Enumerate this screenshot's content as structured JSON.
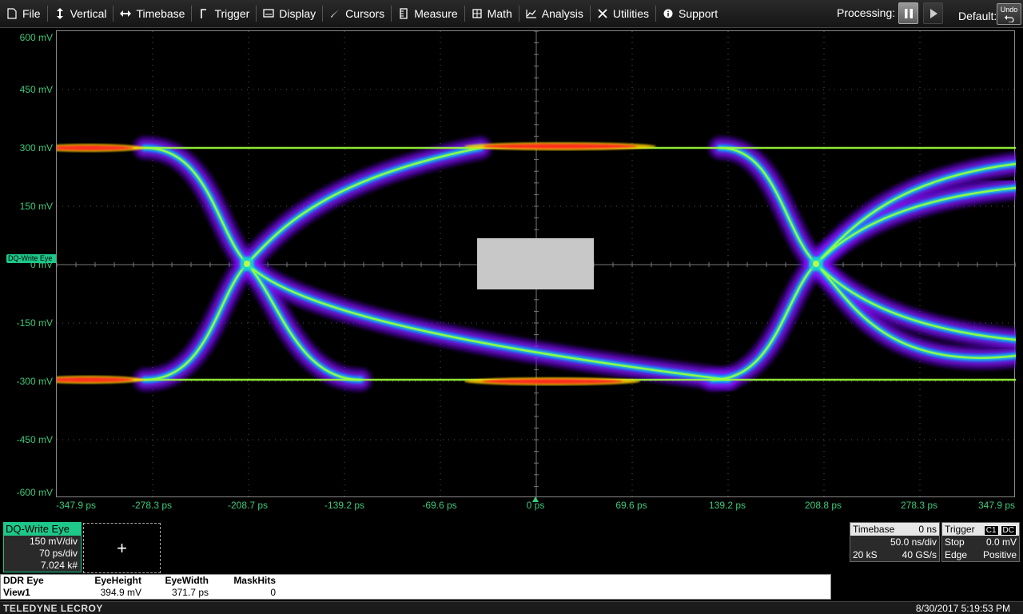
{
  "menu": {
    "items": [
      {
        "key": "file",
        "label": "File",
        "icon": "file-icon"
      },
      {
        "key": "vertical",
        "label": "Vertical",
        "icon": "vertical-arrows-icon"
      },
      {
        "key": "timebase",
        "label": "Timebase",
        "icon": "horizontal-arrows-icon"
      },
      {
        "key": "trigger",
        "label": "Trigger",
        "icon": "trigger-icon"
      },
      {
        "key": "display",
        "label": "Display",
        "icon": "display-icon"
      },
      {
        "key": "cursors",
        "label": "Cursors",
        "icon": "cursor-icon"
      },
      {
        "key": "measure",
        "label": "Measure",
        "icon": "measure-icon"
      },
      {
        "key": "math",
        "label": "Math",
        "icon": "calculator-icon"
      },
      {
        "key": "analysis",
        "label": "Analysis",
        "icon": "analysis-icon"
      },
      {
        "key": "utilities",
        "label": "Utilities",
        "icon": "tools-icon"
      },
      {
        "key": "support",
        "label": "Support",
        "icon": "info-icon"
      }
    ],
    "processing_label": "Processing:",
    "default_label": "Default:",
    "undo_label": "Undo"
  },
  "grid": {
    "y_labels": [
      "600 mV",
      "450 mV",
      "300 mV",
      "150 mV",
      "0 mV",
      "-150 mV",
      "-300 mV",
      "-450 mV",
      "-600 mV"
    ],
    "x_labels": [
      "-347.9 ps",
      "-278.3 ps",
      "-208.7 ps",
      "-139.2 ps",
      "-69.6 ps",
      "0 ps",
      "69.6 ps",
      "139.2 ps",
      "208.8 ps",
      "278.3 ps",
      "347.9 ps"
    ],
    "channel_marker": "DQ-Write Eye",
    "colors": {
      "label": "#3ec97a",
      "channel": "#1ec88a",
      "mask": "#c8c8c8"
    }
  },
  "channel": {
    "title": "DQ-Write Eye",
    "vdiv": "150 mV/div",
    "tdiv": "70 ps/div",
    "count": "7.024 k#"
  },
  "timebase": {
    "label": "Timebase",
    "delay": "0 ns",
    "tdiv": "50.0 ns/div",
    "samples": "20 kS",
    "rate": "40 GS/s"
  },
  "trigger": {
    "label": "Trigger",
    "tag1": "C1",
    "tag2": "DC",
    "mode": "Stop",
    "level": "0.0 mV",
    "type": "Edge",
    "slope": "Positive"
  },
  "measurements": {
    "title": "DDR Eye",
    "row_label": "View1",
    "headers": [
      "EyeHeight",
      "EyeWidth",
      "MaskHits"
    ],
    "values": [
      "394.9 mV",
      "371.7 ps",
      "0"
    ]
  },
  "footer": {
    "brand": "TELEDYNE LECROY",
    "datetime": "8/30/2017 5:19:53 PM"
  }
}
